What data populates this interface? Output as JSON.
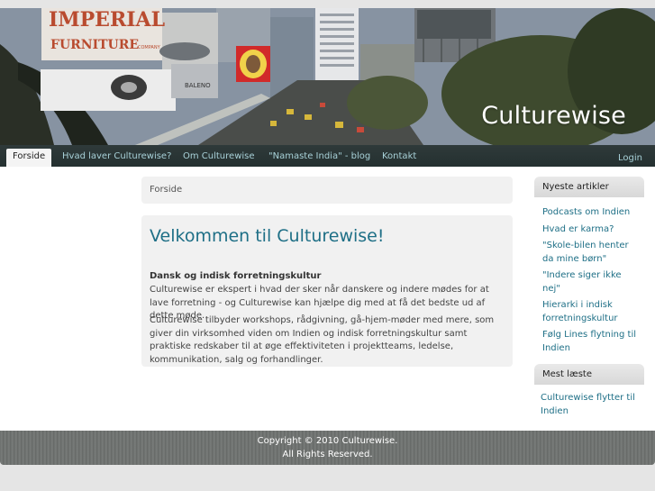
{
  "header": {
    "site_title": "Culturewise",
    "banner_signs": {
      "imperial": "IMPERIAL",
      "furniture": "FURNITURE",
      "company": "COMPANY",
      "baleno": "BALENO"
    }
  },
  "nav": {
    "items": [
      {
        "label": "Forside",
        "active": true
      },
      {
        "label": "Hvad laver Culturewise?"
      },
      {
        "label": "Om Culturewise"
      },
      {
        "label": "\"Namaste India\" - blog"
      },
      {
        "label": "Kontakt"
      }
    ],
    "login": "Login"
  },
  "breadcrumb": "Forside",
  "main": {
    "title": "Velkommen til Culturewise!",
    "subheading": "Dansk og indisk forretningskultur",
    "paragraph1": "Culturewise er ekspert i hvad der sker når danskere og indere mødes for at lave forretning - og Culturewise kan hjælpe dig med at få det bedste ud af dette møde.",
    "paragraph2": "Culturewise tilbyder workshops, rådgivning, gå-hjem-møder med mere, som giver din virksomhed viden om Indien og indisk forretningskultur samt praktiske redskaber til at øge effektiviteten i projektteams, ledelse, kommunikation, salg og forhandlinger."
  },
  "sidebar": {
    "latest_title": "Nyeste artikler",
    "latest": [
      "Podcasts om Indien",
      "Hvad er karma?",
      "\"Skole-bilen henter da mine børn\"",
      "\"Indere siger ikke nej\"",
      "Hierarki i indisk forretningskultur",
      "Følg Lines flytning til Indien"
    ],
    "popular_title": "Mest læste",
    "popular": [
      "Culturewise flytter til Indien"
    ]
  },
  "footer": {
    "copyright": "Copyright © 2010 Culturewise.",
    "rights": "All Rights Reserved."
  },
  "colors": {
    "accent": "#1e6f86",
    "nav_link": "#a8d1d8",
    "navbar_bg": "#2f3a3a"
  }
}
